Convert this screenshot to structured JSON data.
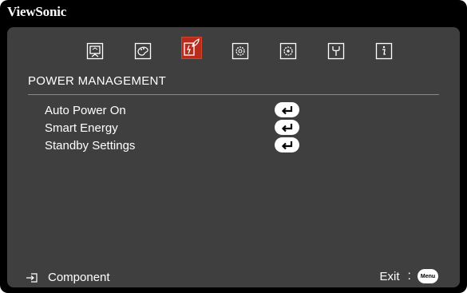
{
  "brand": {
    "name": "ViewSonic"
  },
  "tabs": [
    {
      "icon": "display-icon",
      "active": false
    },
    {
      "icon": "picture-palette-icon",
      "active": false
    },
    {
      "icon": "power-management-icon",
      "active": true
    },
    {
      "icon": "basic-settings-icon",
      "active": false
    },
    {
      "icon": "advanced-settings-icon",
      "active": false
    },
    {
      "icon": "system-icon",
      "active": false
    },
    {
      "icon": "information-icon",
      "active": false
    }
  ],
  "section": {
    "title": "POWER MANAGEMENT"
  },
  "menu": {
    "items": [
      {
        "label": "Auto Power On",
        "action_icon": "enter-icon"
      },
      {
        "label": "Smart Energy",
        "action_icon": "enter-icon"
      },
      {
        "label": "Standby Settings",
        "action_icon": "enter-icon"
      }
    ]
  },
  "footer": {
    "source_icon": "input-source-icon",
    "source_label": "Component",
    "exit_label": "Exit",
    "separator": ":",
    "menu_key_label": "Menu"
  },
  "colors": {
    "background": "#000000",
    "panel": "#3f3f3f",
    "active_tab": "#b82c1b",
    "text": "#ffffff",
    "divider": "#8a8a8a"
  }
}
